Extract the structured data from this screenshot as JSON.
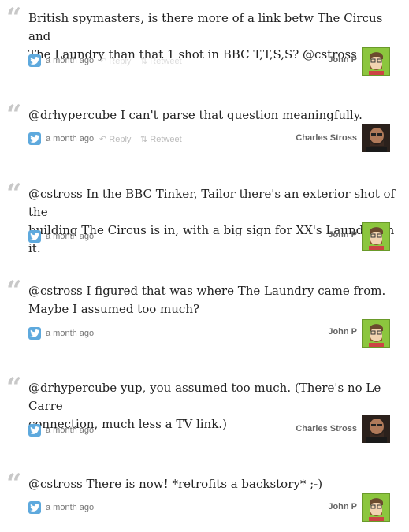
{
  "tweets": [
    {
      "text_lines": [
        "British spymasters, is there more of a link betw The Circus and",
        "The Laundry than that 1 shot in BBC T,T,S,S? @cstross"
      ],
      "time": "a month ago",
      "reply": "Reply",
      "retweet": "Retweet",
      "author": "John P",
      "avatar": "john"
    },
    {
      "text_lines": [
        "@drhypercube I can't parse that question meaningfully."
      ],
      "time": "a month ago",
      "reply": "Reply",
      "retweet": "Retweet",
      "author": "Charles Stross",
      "avatar": "charles"
    },
    {
      "text_lines": [
        "@cstross In the BBC Tinker, Tailor there's an exterior shot of the",
        "building The Circus is in, with a big sign for XX's Laundry on it."
      ],
      "time": "a month ago",
      "author": "John P",
      "avatar": "john"
    },
    {
      "text_lines": [
        "@cstross I figured that was where The Laundry came from.",
        "Maybe I assumed too much?"
      ],
      "time": "a month ago",
      "author": "John P",
      "avatar": "john"
    },
    {
      "text_lines": [
        "@drhypercube yup, you assumed too much. (There's no Le Carre",
        "connection, much less a TV link.)"
      ],
      "time": "a month ago",
      "author": "Charles Stross",
      "avatar": "charles"
    },
    {
      "text_lines": [
        "@cstross There is now! *retrofits a backstory* ;-)"
      ],
      "time": "a month ago",
      "author": "John P",
      "avatar": "john"
    }
  ],
  "icons": {
    "quote": "quote-mark-icon",
    "twitter": "twitter-bird-icon",
    "reply": "reply-arrow-icon",
    "retweet": "retweet-icon"
  },
  "colors": {
    "twitter_blue": "#5ea9dd",
    "quote_gray": "#c8c8c8",
    "avatar_green": "#8cc63e"
  }
}
